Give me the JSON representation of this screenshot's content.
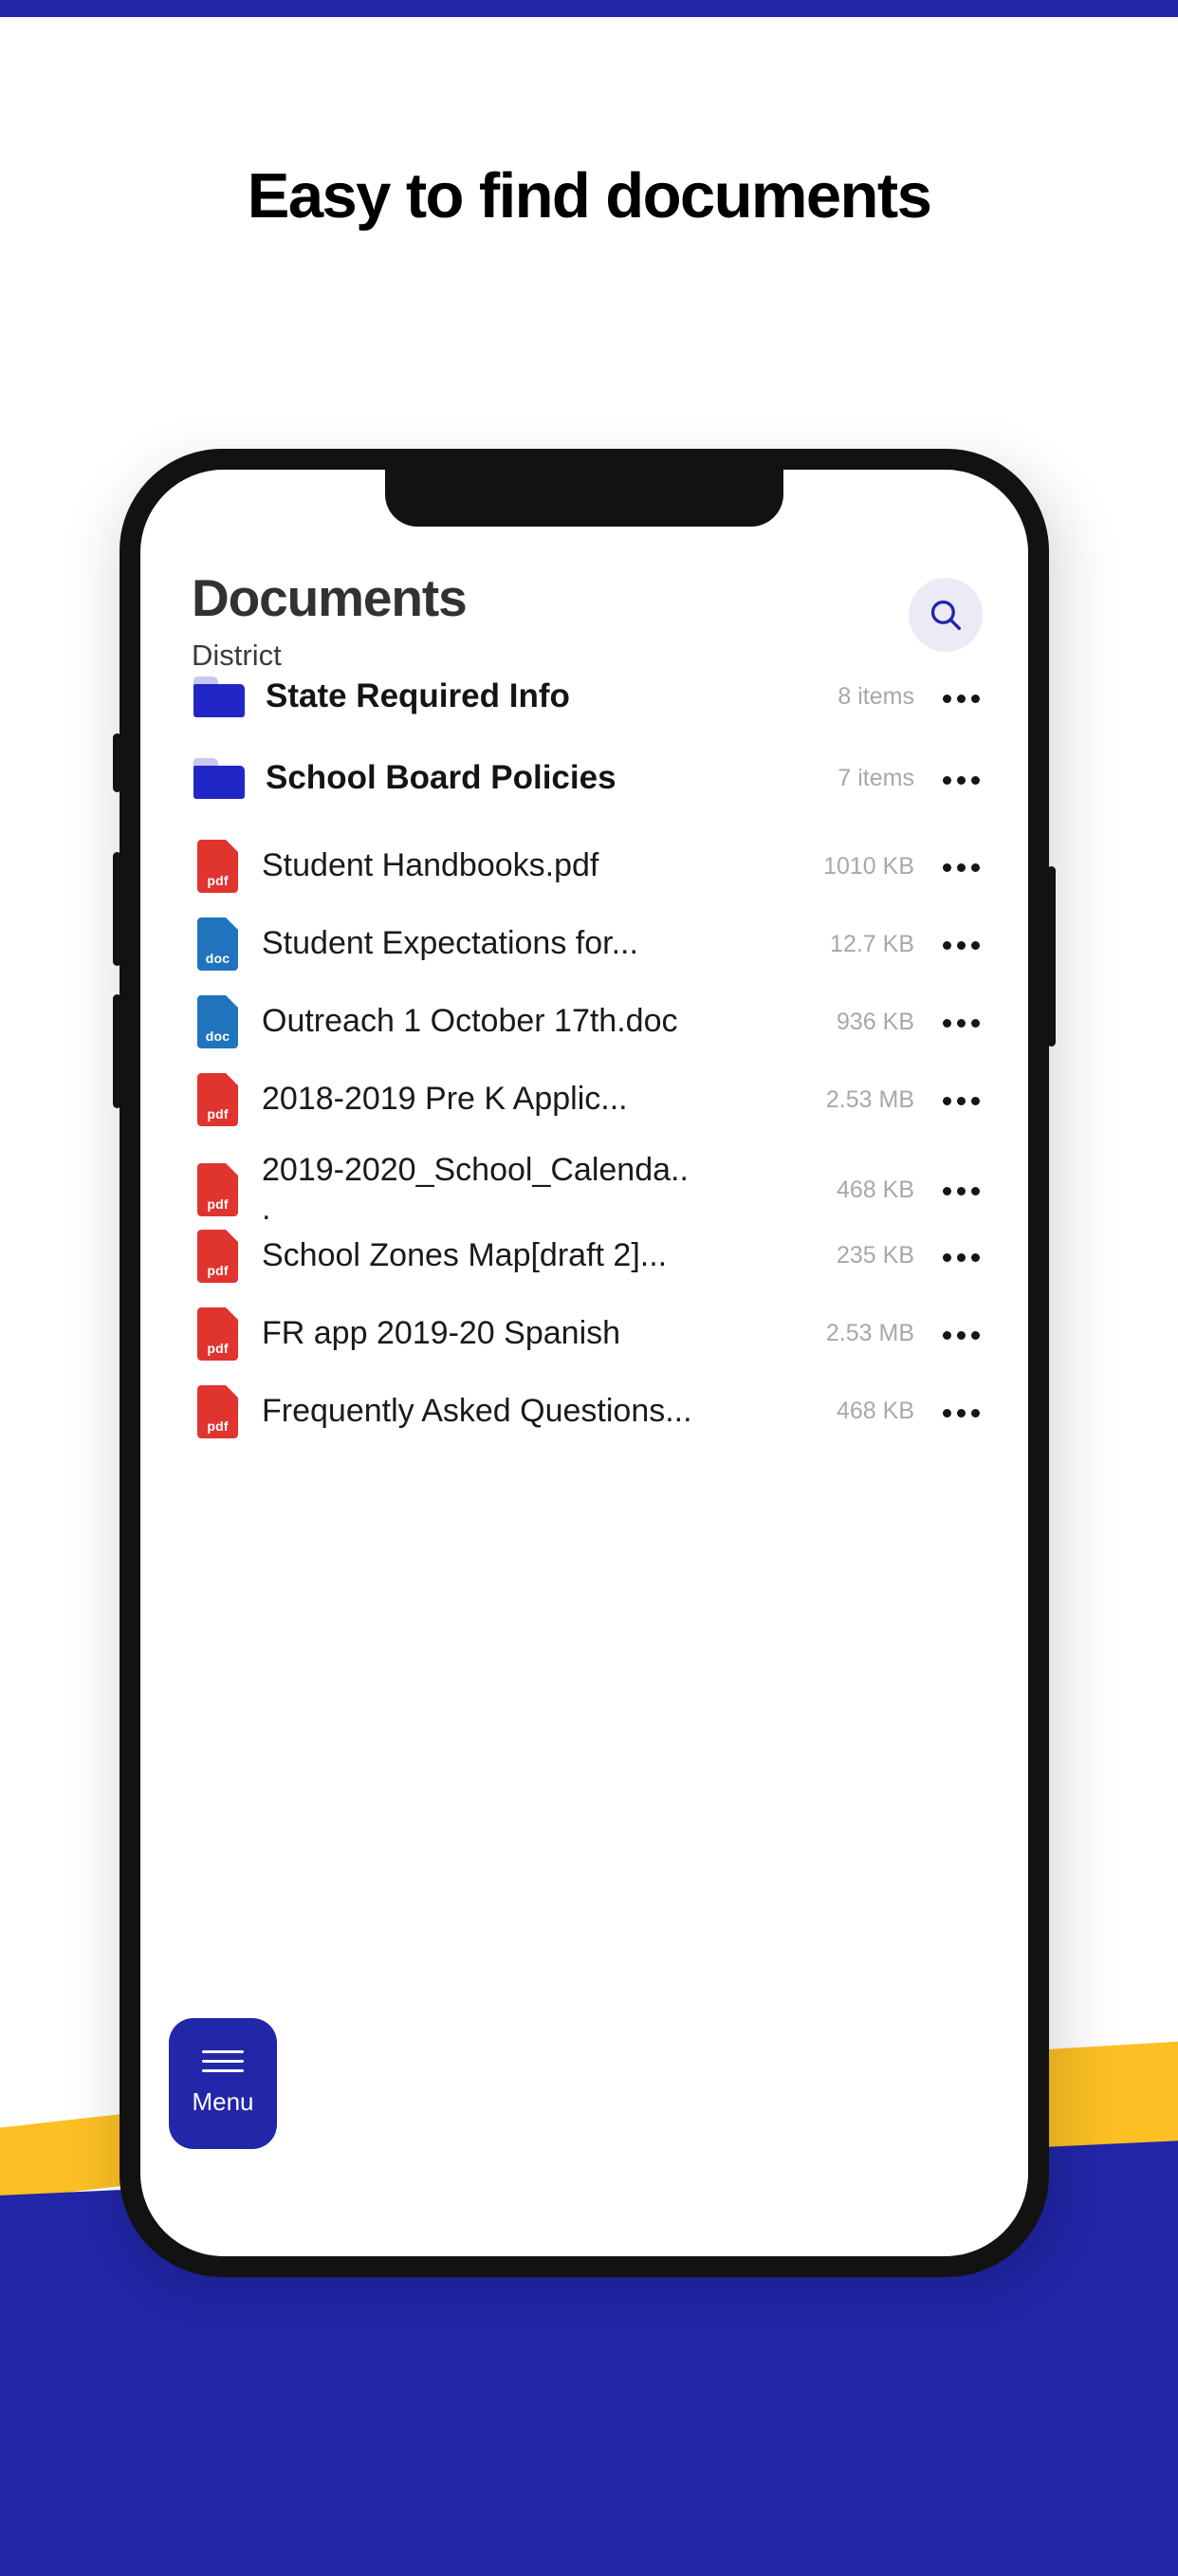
{
  "page": {
    "headline": "Easy to find documents",
    "accent_blue": "#2226a8",
    "accent_yellow": "#fcc024",
    "pdf_red": "#e0342f",
    "doc_blue": "#2074bd",
    "folder_blue": "#2226c5"
  },
  "app": {
    "title": "Documents",
    "subtitle": "District",
    "search_icon": "search-icon",
    "menu": {
      "label": "Menu",
      "icon": "hamburger-icon"
    },
    "rows": [
      {
        "type": "folder",
        "icon": "folder-icon",
        "name": "State Required Info",
        "meta": "8 items",
        "more": "more-options-icon"
      },
      {
        "type": "folder",
        "icon": "folder-icon",
        "name": "School Board Policies",
        "meta": "7 items",
        "more": "more-options-icon"
      },
      {
        "type": "pdf",
        "icon": "pdf-file-icon",
        "ext": "pdf",
        "name": "Student Handbooks.pdf",
        "meta": "1010 KB",
        "more": "more-options-icon"
      },
      {
        "type": "doc",
        "icon": "doc-file-icon",
        "ext": "doc",
        "name": "Student Expectations for...",
        "meta": "12.7 KB",
        "more": "more-options-icon"
      },
      {
        "type": "doc",
        "icon": "doc-file-icon",
        "ext": "doc",
        "name": "Outreach 1 October 17th.doc",
        "meta": "936 KB",
        "more": "more-options-icon"
      },
      {
        "type": "pdf",
        "icon": "pdf-file-icon",
        "ext": "pdf",
        "name": "2018-2019 Pre K Applic...",
        "meta": "2.53 MB",
        "more": "more-options-icon"
      },
      {
        "type": "pdf",
        "icon": "pdf-file-icon",
        "ext": "pdf",
        "name": "2019-2020_School_Calenda..\n.",
        "meta": "468 KB",
        "more": "more-options-icon"
      },
      {
        "type": "pdf",
        "icon": "pdf-file-icon",
        "ext": "pdf",
        "name": "School Zones Map[draft 2]...",
        "meta": "235 KB",
        "more": "more-options-icon"
      },
      {
        "type": "pdf",
        "icon": "pdf-file-icon",
        "ext": "pdf",
        "name": "FR app 2019-20 Spanish",
        "meta": "2.53 MB",
        "more": "more-options-icon"
      },
      {
        "type": "pdf",
        "icon": "pdf-file-icon",
        "ext": "pdf",
        "name": "Frequently Asked Questions...",
        "meta": "468 KB",
        "more": "more-options-icon"
      }
    ]
  }
}
